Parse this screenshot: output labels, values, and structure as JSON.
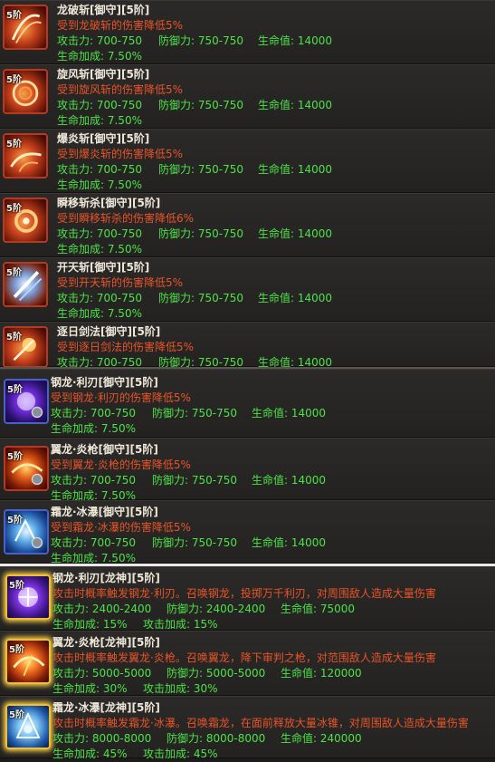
{
  "groups": [
    {
      "cards": [
        {
          "tier": "5阶",
          "name": "龙破斩[御守][5阶]",
          "desc": "受到龙破斩的伤害降低5%",
          "atk": "攻击力:  700-750",
          "def": "防御力:  750-750",
          "hp": "生命值:  14000",
          "bonus": "生命加成:  7.50%",
          "icon": "slash-red-icon"
        },
        {
          "tier": "5阶",
          "name": "旋风斩[御守][5阶]",
          "desc": "受到旋风斩的伤害降低5%",
          "atk": "攻击力:  700-750",
          "def": "防御力:  750-750",
          "hp": "生命值:  14000",
          "bonus": "生命加成:  7.50%",
          "icon": "whirlwind-icon"
        },
        {
          "tier": "5阶",
          "name": "爆炎斩[御守][5阶]",
          "desc": "受到爆炎斩的伤害降低5%",
          "atk": "攻击力:  700-750",
          "def": "防御力:  750-750",
          "hp": "生命值:  14000",
          "bonus": "生命加成:  7.50%",
          "icon": "flame-slash-icon"
        },
        {
          "tier": "5阶",
          "name": "瞬移斩杀[御守][5阶]",
          "desc": "受到瞬移斩杀的伤害降低6%",
          "atk": "攻击力:  700-750",
          "def": "防御力:  750-750",
          "hp": "生命值:  14000",
          "bonus": "生命加成:  7.50%",
          "icon": "blink-strike-icon"
        },
        {
          "tier": "5阶",
          "name": "开天斩[御守][5阶]",
          "desc": "受到开天斩的伤害降低5%",
          "atk": "攻击力:  700-750",
          "def": "防御力:  750-750",
          "hp": "生命值:  14000",
          "bonus": "生命加成:  7.50%",
          "icon": "sky-sword-icon"
        },
        {
          "tier": "5阶",
          "name": "逐日剑法[御守][5阶]",
          "desc": "受到逐日剑法的伤害降低5%",
          "atk": "攻击力:  700-750",
          "def": "防御力:  750-750",
          "hp": "生命值:  14000",
          "bonus": "",
          "icon": "sun-sword-icon"
        }
      ]
    },
    {
      "cards": [
        {
          "tier": "5阶",
          "name": "钢龙·利刃[御守][5阶]",
          "desc": "受到钢龙·利刃的伤害降低5%",
          "atk": "攻击力:  700-750",
          "def": "防御力:  750-750",
          "hp": "生命值:  14000",
          "bonus": "生命加成:  7.50%",
          "icon": "steel-dragon-icon"
        },
        {
          "tier": "5阶",
          "name": "翼龙·炎枪[御守][5阶]",
          "desc": "受到翼龙·炎枪的伤害降低5%",
          "atk": "攻击力:  700-750",
          "def": "防御力:  750-750",
          "hp": "生命值:  14000",
          "bonus": "生命加成:  7.50%",
          "icon": "wyvern-spear-icon"
        },
        {
          "tier": "5阶",
          "name": "霜龙·冰瀑[御守][5阶]",
          "desc": "受到霜龙·冰瀑的伤害降低5%",
          "atk": "攻击力:  700-750",
          "def": "防御力:  750-750",
          "hp": "生命值:  14000",
          "bonus": "生命加成:  7.50%",
          "icon": "frost-dragon-icon"
        }
      ]
    },
    {
      "cards": [
        {
          "tier": "5阶",
          "name": "钢龙·利刃[龙神][5阶]",
          "desc": "攻击时概率触发钢龙·利刃。召唤钢龙，投掷万千利刃，对周围敌人造成大量伤害",
          "atk": "攻击力:  2400-2400",
          "def": "防御力:  2400-2400",
          "hp": "生命值:  75000",
          "bonus": "生命加成:  15%",
          "bonus2": "攻击加成:  15%",
          "icon": "steel-dragon-god-icon"
        },
        {
          "tier": "5阶",
          "name": "翼龙·炎枪[龙神][5阶]",
          "desc": "攻击时概率触发翼龙·炎枪。召唤翼龙，降下审判之枪，对范围敌人造成大量伤害",
          "atk": "攻击力:  5000-5000",
          "def": "防御力:  5000-5000",
          "hp": "生命值:  120000",
          "bonus": "生命加成:  30%",
          "bonus2": "攻击加成:  30%",
          "icon": "wyvern-spear-god-icon"
        },
        {
          "tier": "5阶",
          "name": "霜龙·冰瀑[龙神][5阶]",
          "desc": "攻击时概率触发霜龙·冰瀑。召唤霜龙，在面前释放大量冰锥，对周围敌人造成大量伤害",
          "atk": "攻击力:  8000-8000",
          "def": "防御力:  8000-8000",
          "hp": "生命值:  240000",
          "bonus": "生命加成:  45%",
          "bonus2": "攻击加成:  45%",
          "icon": "frost-dragon-god-icon"
        }
      ]
    }
  ],
  "colors": {
    "name": "#efe8da",
    "desc": "#e8542a",
    "stat": "#4ee24a"
  }
}
